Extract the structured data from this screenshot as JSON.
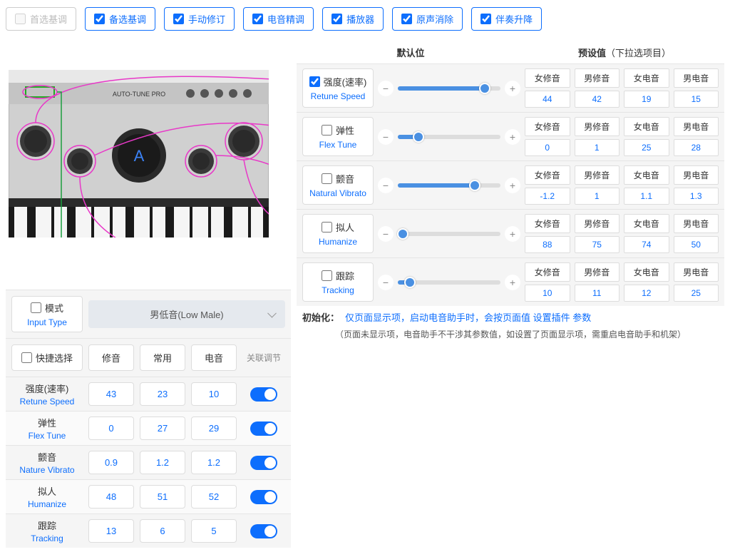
{
  "top_checks": [
    {
      "label": "首选基调",
      "checked": false,
      "disabled": true
    },
    {
      "label": "备选基调",
      "checked": true,
      "disabled": false
    },
    {
      "label": "手动修订",
      "checked": true,
      "disabled": false
    },
    {
      "label": "电音精调",
      "checked": true,
      "disabled": false
    },
    {
      "label": "播放器",
      "checked": true,
      "disabled": false
    },
    {
      "label": "原声消除",
      "checked": true,
      "disabled": false
    },
    {
      "label": "伴奏升降",
      "checked": true,
      "disabled": false
    }
  ],
  "header": {
    "default": "默认位",
    "preset": "预设值",
    "preset_note": "（下拉选项目）"
  },
  "preset_headers": [
    "女修音",
    "男修音",
    "女电音",
    "男电音"
  ],
  "params": [
    {
      "cn": "强度(速率)",
      "en": "Retune Speed",
      "checked": true,
      "slider": 85,
      "presets": [
        "44",
        "42",
        "19",
        "15"
      ]
    },
    {
      "cn": "弹性",
      "en": "Flex Tune",
      "checked": false,
      "slider": 20,
      "presets": [
        "0",
        "1",
        "25",
        "28"
      ]
    },
    {
      "cn": "颤音",
      "en": "Natural Vibrato",
      "checked": false,
      "slider": 75,
      "presets": [
        "-1.2",
        "1",
        "1.1",
        "1.3"
      ]
    },
    {
      "cn": "拟人",
      "en": "Humanize",
      "checked": false,
      "slider": 5,
      "presets": [
        "88",
        "75",
        "74",
        "50"
      ]
    },
    {
      "cn": "跟踪",
      "en": "Tracking",
      "checked": false,
      "slider": 12,
      "presets": [
        "10",
        "11",
        "12",
        "25"
      ]
    }
  ],
  "init": {
    "label": "初始化：",
    "text": "仅页面显示项，启动电音助手时，会按页面值 设置插件 参数",
    "sub": "（页面未显示项，电音助手不干涉其参数值，如设置了页面显示项，需重启电音助手和机架）"
  },
  "mode": {
    "cn": "模式",
    "en": "Input Type",
    "value": "男低音(Low Male)"
  },
  "quick": {
    "main": "快捷选择",
    "cols": [
      "修音",
      "常用",
      "电音"
    ],
    "assoc": "关联调节"
  },
  "bottom_params": [
    {
      "cn": "强度(速率)",
      "en": "Retune Speed",
      "vals": [
        "43",
        "23",
        "10"
      ],
      "alt": false
    },
    {
      "cn": "弹性",
      "en": "Flex Tune",
      "vals": [
        "0",
        "27",
        "29"
      ],
      "alt": true
    },
    {
      "cn": "颤音",
      "en": "Nature Vibrato",
      "vals": [
        "0.9",
        "1.2",
        "1.2"
      ],
      "alt": false
    },
    {
      "cn": "拟人",
      "en": "Humanize",
      "vals": [
        "48",
        "51",
        "52"
      ],
      "alt": true
    },
    {
      "cn": "跟踪",
      "en": "Tracking",
      "vals": [
        "13",
        "6",
        "5"
      ],
      "alt": false
    }
  ],
  "plugin": {
    "title": "AUTO-TUNE PRO",
    "note": "A"
  }
}
